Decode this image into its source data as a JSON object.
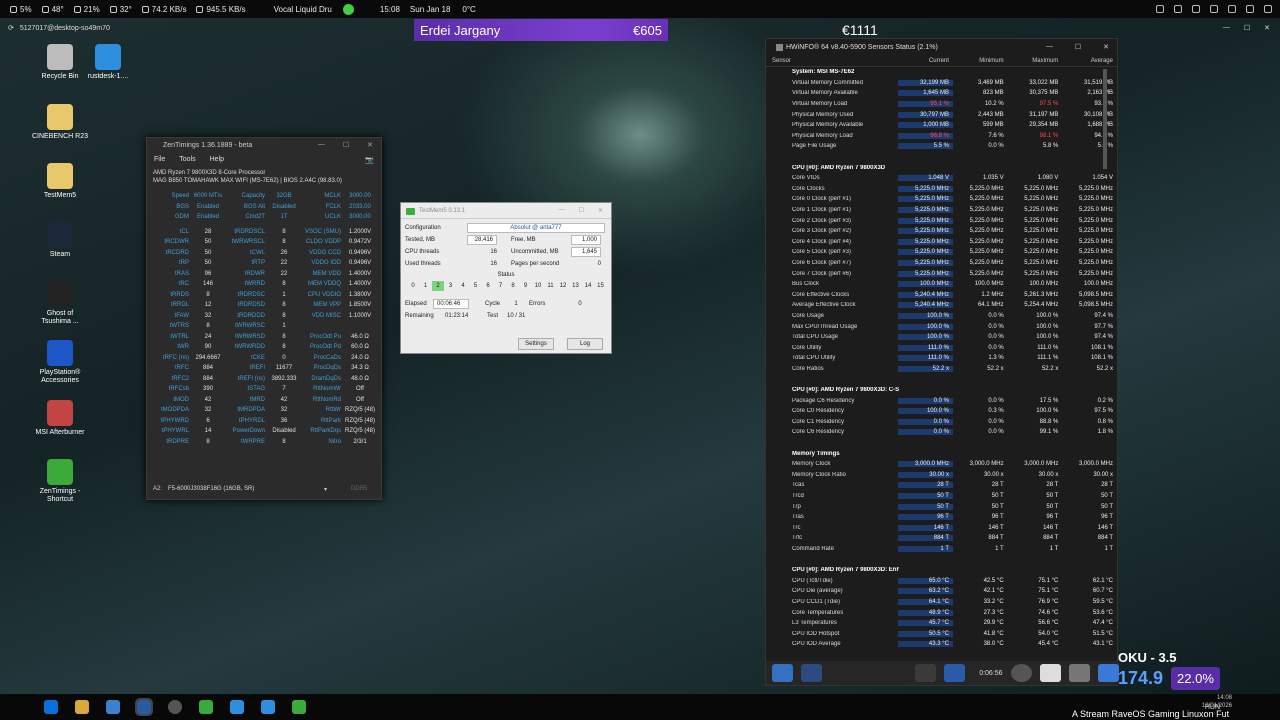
{
  "topbar": {
    "items": [
      {
        "icon": "battery-icon",
        "text": "5%"
      },
      {
        "icon": "brightness-icon",
        "text": "48°"
      },
      {
        "icon": "cpu-icon",
        "text": "21%"
      },
      {
        "icon": "temperature-icon",
        "text": "32°"
      },
      {
        "icon": "network-icon",
        "text": "74.2 KB/s"
      },
      {
        "icon": "download-icon",
        "text": "945.5 KB/s"
      }
    ],
    "media": "Vocal Liquid Dru",
    "time": "15:08",
    "date": "Sun Jan 18",
    "temp": "0°C"
  },
  "secbar": {
    "host": "5127017@desktop-so49m70"
  },
  "overlay": {
    "name": "Erdei Jargany",
    "amount1": "€605",
    "amount2": "€1111"
  },
  "desktop": [
    {
      "label": "Recycle Bin",
      "color": "#bcbcbc"
    },
    {
      "label": "rustdesk-1....",
      "color": "#2e8fe0"
    },
    {
      "label": "CINEBENCH R23",
      "color": "#e8c86a"
    },
    {
      "label": "TestMem5",
      "color": "#e8c86a"
    },
    {
      "label": "Steam",
      "color": "#1b2838"
    },
    {
      "label": "Ghost of Tsushima ...",
      "color": "#222222"
    },
    {
      "label": "PlayStation® Accessories",
      "color": "#1d56c6"
    },
    {
      "label": "MSI Afterburner",
      "color": "#c44444"
    },
    {
      "label": "ZenTimings - Shortcut",
      "color": "#3aaa3a"
    }
  ],
  "zentimings": {
    "title": "ZenTimings 1.36.1889 - beta",
    "menu": [
      "File",
      "Tools",
      "Help"
    ],
    "cpu": "AMD Ryzen 7 9800X3D 8-Core Processor",
    "board": "MAG B850 TOMAHAWK MAX WIFI (MS-7E62) | BIOS 2.A4C (98.83.0)",
    "top": [
      [
        "Speed",
        "6000 MT/s",
        "Capacity",
        "32GB",
        "MCLK",
        "3000.00"
      ],
      [
        "BGS",
        "Enabled",
        "BGS Alt",
        "Disabled",
        "FCLK",
        "2033.00"
      ],
      [
        "GDM",
        "Enabled",
        "Cmd2T",
        "1T",
        "UCLK",
        "3000.00"
      ]
    ],
    "rows": [
      [
        "tCL",
        "28",
        "tRDRDSCL",
        "8",
        "VSOC (SMU)",
        "1.2000V"
      ],
      [
        "tRCDWR",
        "50",
        "tWRWRSCL",
        "8",
        "CLDO VDDP",
        "0.9472V"
      ],
      [
        "tRCDRD",
        "50",
        "tCWL",
        "26",
        "VDDG CCD",
        "0.9496V"
      ],
      [
        "tRP",
        "50",
        "tRTP",
        "22",
        "VDDG IOD",
        "0.9496V"
      ],
      [
        "tRAS",
        "96",
        "tRDWR",
        "22",
        "MEM VDD",
        "1.4000V"
      ],
      [
        "tRC",
        "146",
        "tWRRD",
        "8",
        "MEM VDDQ",
        "1.4000V"
      ],
      [
        "tRRDS",
        "8",
        "tRDRDSC",
        "1",
        "CPU VDDIO",
        "1.3800V"
      ],
      [
        "tRRDL",
        "12",
        "tRDRDSD",
        "8",
        "MEM VPP",
        "1.8500V"
      ],
      [
        "tFAW",
        "32",
        "tRDRDDD",
        "8",
        "VDD MISC",
        "1.1000V"
      ],
      [
        "tWTRS",
        "8",
        "tWRWRSC",
        "1",
        "",
        ""
      ],
      [
        "tWTRL",
        "24",
        "tWRWRSD",
        "8",
        "ProcOdt Pu",
        "46.0 Ω"
      ],
      [
        "tWR",
        "90",
        "tWRWRDD",
        "8",
        "ProcOdt Pd",
        "60.0 Ω"
      ],
      [
        "tRFC (ns)",
        "294.6667",
        "tCKE",
        "0",
        "ProcCaDs",
        "24.0 Ω"
      ],
      [
        "tRFC",
        "884",
        "tREFI",
        "11677",
        "ProcDqDs",
        "34.3 Ω"
      ],
      [
        "tRFC2",
        "884",
        "tREFI (ns)",
        "3892.333",
        "DramDqDs",
        "48.0 Ω"
      ],
      [
        "tRFCsb",
        "390",
        "tSTAG",
        "7",
        "RttNomWr",
        "Off"
      ],
      [
        "tMOD",
        "42",
        "tMRD",
        "42",
        "RttNomRd",
        "Off"
      ],
      [
        "tMODPDA",
        "32",
        "tMRDPDA",
        "32",
        "RttWr",
        "RZQ/5 (48)"
      ],
      [
        "tPHYWRD",
        "6",
        "tPHYRDL",
        "36",
        "RttPark",
        "RZQ/5 (48)"
      ],
      [
        "tPHYWRL",
        "14",
        "PowerDown",
        "Disabled",
        "RttParkDqs",
        "RZQ/5 (48)"
      ],
      [
        "tRDPRE",
        "8",
        "tWRPRE",
        "8",
        "Nitro",
        "2/3/1"
      ]
    ],
    "slot": "A2:",
    "module": "F5-6000J3038F16G (16GB, SR)",
    "ddr": "DDR5"
  },
  "testmem": {
    "title": "TestMem5 0.13.1",
    "config_label": "Configuration",
    "config": "Absolut @ anta777",
    "tested_label": "Tested, MB",
    "tested": "28,416",
    "free_label": "Free, MB",
    "free": "1,000",
    "cpu_label": "CPU threads",
    "cpu": "16",
    "uncommitted_label": "Uncommitted, MB",
    "uncommitted": "1,645",
    "used_label": "Used threads",
    "used": "16",
    "pages_label": "Pages per second",
    "pages": "0",
    "status_label": "Status",
    "threads": [
      "0",
      "1",
      "2",
      "3",
      "4",
      "5",
      "6",
      "7",
      "8",
      "9",
      "10",
      "11",
      "12",
      "13",
      "14",
      "15"
    ],
    "active_thread": 2,
    "elapsed_label": "Elapsed",
    "elapsed": "00:06:46",
    "cycle_label": "Cycle",
    "cycle": "1",
    "errors_label": "Errors",
    "errors": "0",
    "remaining_label": "Remaining",
    "remaining": "01:23:14",
    "test_label": "Test",
    "test": "10 / 31",
    "settings": "Settings",
    "log": "Log"
  },
  "hwinfo": {
    "title": "HWiNFO® 64 v8.40-5900 Sensors Status (2.1%)",
    "headers": [
      "Sensor",
      "Current",
      "Minimum",
      "Maximum",
      "Average"
    ],
    "rows": [
      {
        "s": 1,
        "n": "System: MSI MS-7E62"
      },
      {
        "n": "Virtual Memory Committed",
        "v": [
          "32,199 MB",
          "3,469 MB",
          "33,022 MB",
          "31,519 MB"
        ]
      },
      {
        "n": "Virtual Memory Available",
        "v": [
          "1,645 MB",
          "823 MB",
          "30,375 MB",
          "2,163 MB"
        ]
      },
      {
        "n": "Virtual Memory Load",
        "v": [
          "95.1 %",
          "10.2 %",
          "97.5 %",
          "93.1 %"
        ],
        "r": [
          0,
          2
        ]
      },
      {
        "n": "Physical Memory Used",
        "v": [
          "30,797 MB",
          "2,443 MB",
          "31,197 MB",
          "30,108 MB"
        ]
      },
      {
        "n": "Physical Memory Available",
        "v": [
          "1,000 MB",
          "599 MB",
          "29,354 MB",
          "1,688 MB"
        ]
      },
      {
        "n": "Physical Memory Load",
        "v": [
          "96.8 %",
          "7.6 %",
          "98.1 %",
          "94.6 %"
        ],
        "r": [
          0,
          2
        ]
      },
      {
        "n": "Page File Usage",
        "v": [
          "5.5 %",
          "0.0 %",
          "5.8 %",
          "5.0 %"
        ]
      },
      {
        "n": ""
      },
      {
        "s": 1,
        "n": "CPU [#0]: AMD Ryzen 7 9800X3D"
      },
      {
        "n": "Core VIDs",
        "v": [
          "1.048 V",
          "1.035 V",
          "1.080 V",
          "1.054 V"
        ]
      },
      {
        "n": "Core Clocks",
        "v": [
          "5,225.0 MHz",
          "5,225.0 MHz",
          "5,225.0 MHz",
          "5,225.0 MHz"
        ]
      },
      {
        "n": "Core 0 Clock (perf #1)",
        "v": [
          "5,225.0 MHz",
          "5,225.0 MHz",
          "5,225.0 MHz",
          "5,225.0 MHz"
        ]
      },
      {
        "n": "Core 1 Clock (perf #1)",
        "v": [
          "5,225.0 MHz",
          "5,225.0 MHz",
          "5,225.0 MHz",
          "5,225.0 MHz"
        ]
      },
      {
        "n": "Core 2 Clock (perf #3)",
        "v": [
          "5,225.0 MHz",
          "5,225.0 MHz",
          "5,225.0 MHz",
          "5,225.0 MHz"
        ]
      },
      {
        "n": "Core 3 Clock (perf #2)",
        "v": [
          "5,225.0 MHz",
          "5,225.0 MHz",
          "5,225.0 MHz",
          "5,225.0 MHz"
        ]
      },
      {
        "n": "Core 4 Clock (perf #4)",
        "v": [
          "5,225.0 MHz",
          "5,225.0 MHz",
          "5,225.0 MHz",
          "5,225.0 MHz"
        ]
      },
      {
        "n": "Core 5 Clock (perf #3)",
        "v": [
          "5,225.0 MHz",
          "5,225.0 MHz",
          "5,225.0 MHz",
          "5,225.0 MHz"
        ]
      },
      {
        "n": "Core 6 Clock (perf #7)",
        "v": [
          "5,225.0 MHz",
          "5,225.0 MHz",
          "5,225.0 MHz",
          "5,225.0 MHz"
        ]
      },
      {
        "n": "Core 7 Clock (perf #6)",
        "v": [
          "5,225.0 MHz",
          "5,225.0 MHz",
          "5,225.0 MHz",
          "5,225.0 MHz"
        ]
      },
      {
        "n": "Bus Clock",
        "v": [
          "100.0 MHz",
          "100.0 MHz",
          "100.0 MHz",
          "100.0 MHz"
        ]
      },
      {
        "n": "Core Effective Clocks",
        "v": [
          "5,240.4 MHz",
          "1.2 MHz",
          "5,261.3 MHz",
          "5,098.5 MHz"
        ]
      },
      {
        "n": "Average Effective Clock",
        "v": [
          "5,240.4 MHz",
          "64.1 MHz",
          "5,254.4 MHz",
          "5,098.5 MHz"
        ]
      },
      {
        "n": "Core Usage",
        "v": [
          "100.0 %",
          "0.0 %",
          "100.0 %",
          "97.4 %"
        ]
      },
      {
        "n": "Max CPU/Thread Usage",
        "v": [
          "100.0 %",
          "0.0 %",
          "100.0 %",
          "97.7 %"
        ]
      },
      {
        "n": "Total CPU Usage",
        "v": [
          "100.0 %",
          "0.0 %",
          "100.0 %",
          "97.4 %"
        ]
      },
      {
        "n": "Core Utility",
        "v": [
          "111.0 %",
          "0.0 %",
          "111.0 %",
          "108.1 %"
        ]
      },
      {
        "n": "Total CPU Utility",
        "v": [
          "111.0 %",
          "1.3 %",
          "111.1 %",
          "108.1 %"
        ]
      },
      {
        "n": "Core Ratios",
        "v": [
          "52.2 x",
          "52.2 x",
          "52.2 x",
          "52.2 x"
        ]
      },
      {
        "n": ""
      },
      {
        "s": 1,
        "n": "CPU [#0]: AMD Ryzen 7 9800X3D: C-State Residency"
      },
      {
        "n": "Package C6 Residency",
        "v": [
          "0.0 %",
          "0.0 %",
          "17.5 %",
          "0.2 %"
        ]
      },
      {
        "n": "Core C0 Residency",
        "v": [
          "100.0 %",
          "0.3 %",
          "100.0 %",
          "97.5 %"
        ]
      },
      {
        "n": "Core C1 Residency",
        "v": [
          "0.0 %",
          "0.0 %",
          "88.8 %",
          "0.8 %"
        ]
      },
      {
        "n": "Core C6 Residency",
        "v": [
          "0.0 %",
          "0.0 %",
          "99.1 %",
          "1.8 %"
        ]
      },
      {
        "n": ""
      },
      {
        "s": 1,
        "n": "Memory Timings"
      },
      {
        "n": "Memory Clock",
        "v": [
          "3,000.0 MHz",
          "3,000.0 MHz",
          "3,000.0 MHz",
          "3,000.0 MHz"
        ]
      },
      {
        "n": "Memory Clock Ratio",
        "v": [
          "30.00 x",
          "30.00 x",
          "30.00 x",
          "30.00 x"
        ]
      },
      {
        "n": "Tcas",
        "v": [
          "28 T",
          "28 T",
          "28 T",
          "28 T"
        ]
      },
      {
        "n": "Trcd",
        "v": [
          "50 T",
          "50 T",
          "50 T",
          "50 T"
        ]
      },
      {
        "n": "Trp",
        "v": [
          "50 T",
          "50 T",
          "50 T",
          "50 T"
        ]
      },
      {
        "n": "Tras",
        "v": [
          "96 T",
          "96 T",
          "96 T",
          "96 T"
        ]
      },
      {
        "n": "Trc",
        "v": [
          "146 T",
          "146 T",
          "146 T",
          "146 T"
        ]
      },
      {
        "n": "Trfc",
        "v": [
          "884 T",
          "884 T",
          "884 T",
          "884 T"
        ]
      },
      {
        "n": "Command Rate",
        "v": [
          "1 T",
          "1 T",
          "1 T",
          "1 T"
        ]
      },
      {
        "n": ""
      },
      {
        "s": 1,
        "n": "CPU [#0]: AMD Ryzen 7 9800X3D: Enhanced"
      },
      {
        "n": "CPU (Tctl/Tdie)",
        "v": [
          "65.0 °C",
          "42.5 °C",
          "75.1 °C",
          "62.1 °C"
        ]
      },
      {
        "n": "CPU Die (average)",
        "v": [
          "63.2 °C",
          "42.1 °C",
          "75.1 °C",
          "60.7 °C"
        ]
      },
      {
        "n": "CPU CCD1 (Tdie)",
        "v": [
          "64.1 °C",
          "33.2 °C",
          "76.9 °C",
          "59.5 °C"
        ]
      },
      {
        "n": "Core Temperatures",
        "v": [
          "48.9 °C",
          "27.3 °C",
          "74.6 °C",
          "53.6 °C"
        ]
      },
      {
        "n": "L3 Temperatures",
        "v": [
          "45.7 °C",
          "29.9 °C",
          "56.6 °C",
          "47.4 °C"
        ]
      },
      {
        "n": "CPU IOD Hotspot",
        "v": [
          "50.5 °C",
          "41.8 °C",
          "54.0 °C",
          "51.5 °C"
        ]
      },
      {
        "n": "CPU IOD Average",
        "v": [
          "43.3 °C",
          "38.0 °C",
          "45.4 °C",
          "43.1 °C"
        ]
      }
    ],
    "timer": "0:06:56"
  },
  "stream": {
    "title": "OKU - 3.5",
    "value": "174.9",
    "percent": "22.0%"
  },
  "marquee": "A Stream RaveOS Gaming Linuxon Fut",
  "taskbar": {
    "tray_time": "14:08",
    "tray_lang": "HUN",
    "tray_date": "18/01/2026"
  }
}
